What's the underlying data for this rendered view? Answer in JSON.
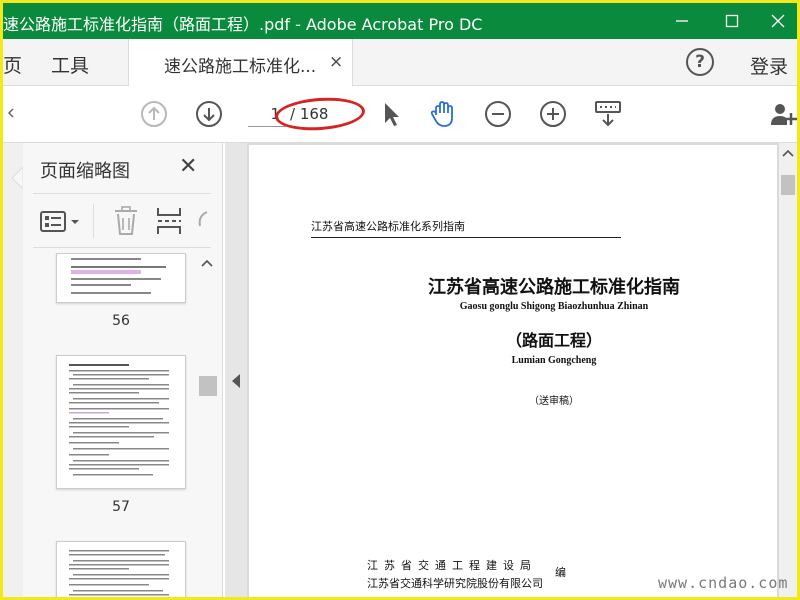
{
  "window": {
    "title": "速公路施工标准化指南（路面工程）.pdf - Adobe Acrobat Pro DC",
    "colors": {
      "titlebar": "#0a8a3c",
      "frame": "#f3e81c",
      "annotation": "#d62424",
      "hand_tool": "#2a6fd6"
    }
  },
  "tabs": {
    "home_label": "页",
    "tools_label": "工具",
    "document_label": "速公路施工标准化...",
    "close_glyph": "×"
  },
  "header": {
    "help_glyph": "?",
    "login_label": "登录"
  },
  "toolbar": {
    "current_page": "1",
    "total_pages": "/ 168",
    "icons": [
      "arrow-up-circle-icon",
      "arrow-down-circle-icon",
      "select-cursor-icon",
      "hand-tool-icon",
      "zoom-out-icon",
      "zoom-in-icon",
      "keyboard-scroll-icon",
      "add-user-icon"
    ]
  },
  "thumbnails_panel": {
    "title": "页面缩略图",
    "close_glyph": "✕",
    "pages": [
      {
        "number": "56"
      },
      {
        "number": "57"
      },
      {
        "number": ""
      }
    ]
  },
  "document": {
    "header": "江苏省高速公路标准化系列指南",
    "title": "江苏省高速公路施工标准化指南",
    "title_pinyin": "Gaosu gonglu Shigong Biaozhunhua Zhinan",
    "subtitle": "（路面工程）",
    "subtitle_pinyin": "Lumian Gongcheng",
    "draft_note": "（送审稿）",
    "org_line1": "江苏省交通工程建设局",
    "org_line2": "江苏省交通科学研究院股份有限公司",
    "edit_mark": "编"
  },
  "watermark": "www.cndao.com"
}
